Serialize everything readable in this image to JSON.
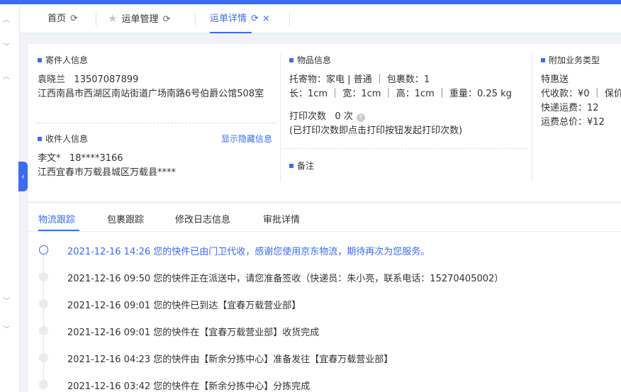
{
  "tabs": [
    {
      "label": "首页"
    },
    {
      "label": "运单管理"
    },
    {
      "label": "运单详情"
    }
  ],
  "sender": {
    "title": "寄件人信息",
    "name": "袁晓兰",
    "phone": "13507087899",
    "address": "江西南昌市西湖区南站街道广场南路6号伯爵公馆508室"
  },
  "receiver": {
    "title": "收件人信息",
    "toggle_label": "显示隐藏信息",
    "name": "李文*",
    "phone": "18****3166",
    "address": "江西宜春市万载县城区万载县****"
  },
  "goods": {
    "title": "物品信息",
    "line1": "托寄物：家电 | 普通 ｜ 包裹数：1",
    "line2": "长：1cm ｜ 宽：1cm ｜ 高：1cm ｜ 重量：0.25 kg",
    "print_label": "打印次数",
    "print_count": "0 次",
    "print_note": "(已打印次数即点击打印按钮发起打印次数)",
    "remark_title": "备注"
  },
  "addon": {
    "title": "附加业务类型",
    "type": "特惠送",
    "cod": "代收款：¥0 ｜ 保价",
    "fee": "快递运费：12",
    "total": "运费总价：¥12"
  },
  "track_tabs": [
    "物流跟踪",
    "包裹跟踪",
    "修改日志信息",
    "审批详情"
  ],
  "timeline": [
    {
      "time": "2021-12-16 14:26",
      "text": "您的快件已由门卫代收，感谢您使用京东物流，期待再次为您服务。"
    },
    {
      "time": "2021-12-16 09:50",
      "text": "您的快件正在派送中，请您准备签收（快递员：朱小亮，联系电话：15270405002）"
    },
    {
      "time": "2021-12-16 09:01",
      "text": "您的快件已到达【宜春万载营业部】"
    },
    {
      "time": "2021-12-16 09:01",
      "text": "您的快件在【宜春万载营业部】收货完成"
    },
    {
      "time": "2021-12-16 04:23",
      "text": "您的快件由【新余分拣中心】准备发往【宜春万载营业部】"
    },
    {
      "time": "2021-12-16 03:42",
      "text": "您的快件在【新余分拣中心】分拣完成"
    }
  ],
  "colors": {
    "accent": "#3c6cf0"
  }
}
